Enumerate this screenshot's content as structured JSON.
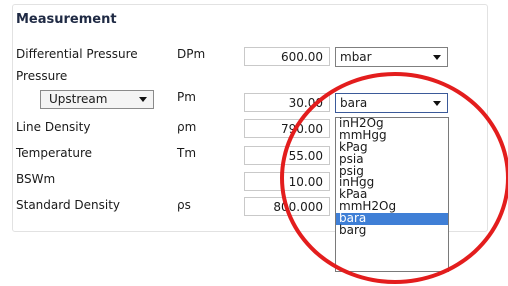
{
  "section": {
    "title": "Measurement"
  },
  "rows": [
    {
      "label": "Differential Pressure",
      "symbol": "DPm",
      "value": "600.00",
      "unit": "mbar"
    },
    {
      "label": "Pressure"
    },
    {
      "symbol": "Pm",
      "value": "30.00",
      "unit": "bara"
    },
    {
      "label": "Line Density",
      "symbol": "ρm",
      "value": "790.00"
    },
    {
      "label": "Temperature",
      "symbol": "Tm",
      "value": "55.00"
    },
    {
      "label": "BSWm",
      "value": "10.00"
    },
    {
      "label": "Standard Density",
      "symbol": "ρs",
      "value": "800.000"
    }
  ],
  "pressure_location": {
    "selected": "Upstream"
  },
  "unit_dropdown": {
    "options": [
      "inH2Og",
      "mmHgg",
      "kPag",
      "psia",
      "psig",
      "inHgg",
      "kPaa",
      "mmH2Og",
      "bara",
      "barg"
    ],
    "selected": "bara"
  },
  "colors": {
    "highlight_ring": "#e31d1d",
    "selection": "#3f7fd6",
    "title": "#1f2a44"
  }
}
